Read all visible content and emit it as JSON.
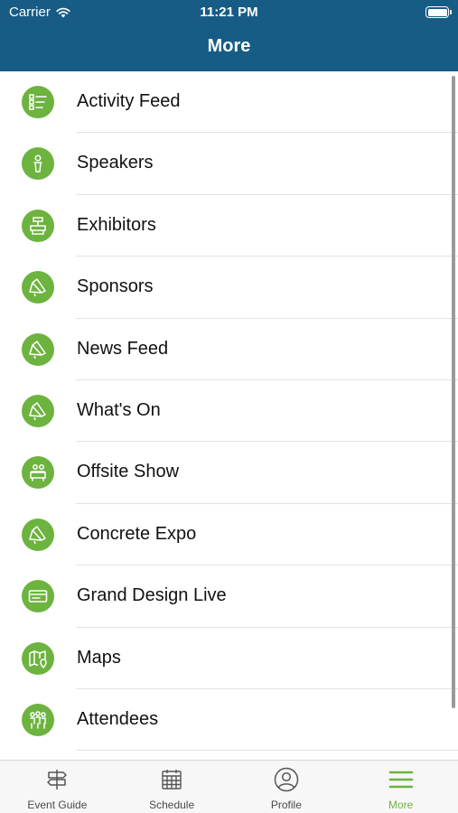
{
  "status_bar": {
    "carrier": "Carrier",
    "time": "11:21 PM",
    "battery_level": 1.0
  },
  "nav": {
    "title": "More"
  },
  "menu": {
    "items": [
      {
        "label": "Activity Feed",
        "icon": "list-icon"
      },
      {
        "label": "Speakers",
        "icon": "speaker-icon"
      },
      {
        "label": "Exhibitors",
        "icon": "exhibitor-stand-icon"
      },
      {
        "label": "Sponsors",
        "icon": "megaphone-icon"
      },
      {
        "label": "News Feed",
        "icon": "megaphone-icon"
      },
      {
        "label": "What's On",
        "icon": "megaphone-icon"
      },
      {
        "label": "Offsite Show",
        "icon": "presenter-desk-icon"
      },
      {
        "label": "Concrete Expo",
        "icon": "megaphone-icon"
      },
      {
        "label": "Grand Design Live",
        "icon": "ticket-card-icon"
      },
      {
        "label": "Maps",
        "icon": "map-pin-icon"
      },
      {
        "label": "Attendees",
        "icon": "people-icon"
      },
      {
        "label": "",
        "icon": ""
      }
    ]
  },
  "tabs": [
    {
      "label": "Event Guide",
      "icon": "signpost-icon"
    },
    {
      "label": "Schedule",
      "icon": "calendar-icon"
    },
    {
      "label": "Profile",
      "icon": "profile-icon"
    },
    {
      "label": "More",
      "icon": "hamburger-menu-icon"
    }
  ],
  "colors": {
    "header": "#175c85",
    "accent": "#6db33f",
    "separator": "#e3e3e3"
  }
}
